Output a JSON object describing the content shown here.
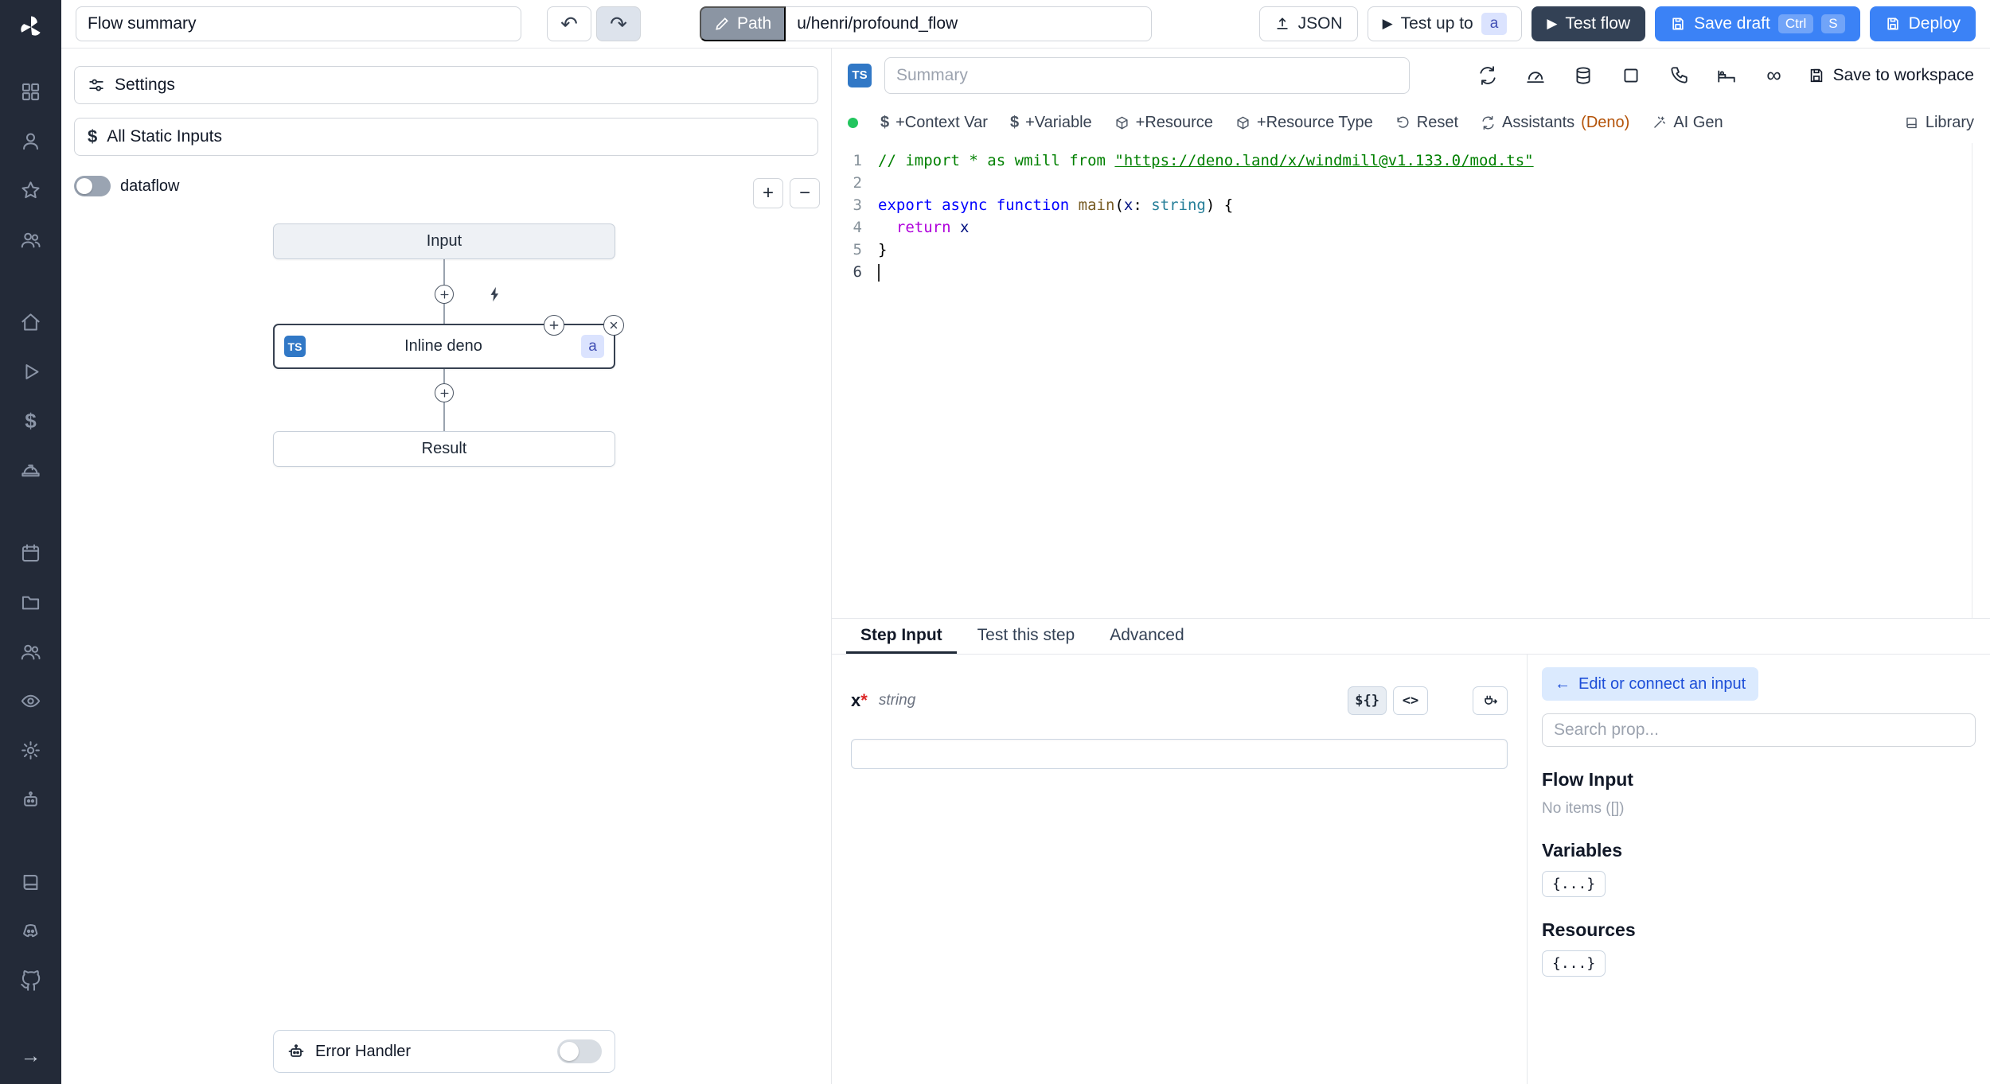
{
  "colors": {
    "accent_blue": "#3b82f6",
    "dark_button": "#334155",
    "ts_badge": "#3178c6",
    "green_dot": "#22c55e",
    "sidebar_bg": "#232a38"
  },
  "icons": {
    "arrow_left": "←",
    "arrow_right": "→",
    "undo": "↶",
    "redo": "↷",
    "play": "▶",
    "dollar": "$",
    "infinity": "∞",
    "plus": "+",
    "minus": "−",
    "dollar_braces": "${}",
    "code_tag": "<>"
  },
  "sidebar": {
    "icon_names": [
      "windmill-logo",
      "apps-grid",
      "user",
      "star",
      "users",
      "home",
      "play",
      "dollar",
      "hard-hat",
      "calendar",
      "folder",
      "members",
      "eye",
      "gear",
      "robot",
      "book",
      "discord",
      "github",
      "expand-arrow"
    ]
  },
  "topbar": {
    "flow_summary_value": "Flow summary",
    "path_label": "Path",
    "path_value": "u/henri/profound_flow",
    "json_label": "JSON",
    "test_up_to_label": "Test up to",
    "test_up_to_badge": "a",
    "test_flow_label": "Test flow",
    "save_draft_label": "Save draft",
    "kbd_ctrl": "Ctrl",
    "kbd_s": "S",
    "deploy_label": "Deploy"
  },
  "flow": {
    "settings_label": "Settings",
    "static_inputs_label": "All Static Inputs",
    "dataflow_label": "dataflow",
    "input_node": "Input",
    "inline_node": "Inline deno",
    "inline_lang_badge": "TS",
    "inline_badge": "a",
    "result_node": "Result",
    "error_handler_label": "Error Handler"
  },
  "editor": {
    "lang_badge": "TS",
    "summary_placeholder": "Summary",
    "save_to_workspace": "Save to workspace",
    "header_icon_names": [
      "restart",
      "gauge",
      "database",
      "concurrency-square",
      "phone",
      "sleep",
      "infinity"
    ],
    "toolbar": {
      "context_var": "+Context Var",
      "variable": "+Variable",
      "resource": "+Resource",
      "resource_type": "+Resource Type",
      "reset": "Reset",
      "assistants": "Assistants",
      "assistants_lang": "(Deno)",
      "ai_gen": "AI Gen",
      "library": "Library"
    },
    "code": {
      "cursor_line": 6,
      "lines": [
        [
          [
            "// import * as wmill from ",
            "cm"
          ],
          [
            "\"https://deno.land/x/windmill@v1.133.0/mod.ts\"",
            "cml"
          ]
        ],
        [],
        [
          [
            "export async function ",
            "kw"
          ],
          [
            "main",
            "fn"
          ],
          [
            "(",
            "pl"
          ],
          [
            "x",
            "pr"
          ],
          [
            ": ",
            "pl"
          ],
          [
            "string",
            "ty"
          ],
          [
            ") {",
            "pl"
          ]
        ],
        [
          [
            "  ",
            "pl"
          ],
          [
            "return",
            "ct"
          ],
          [
            " ",
            "pl"
          ],
          [
            "x",
            "pr"
          ]
        ],
        [
          [
            "}",
            "pl"
          ]
        ],
        []
      ]
    }
  },
  "tabs": [
    {
      "label": "Step Input"
    },
    {
      "label": "Test this step"
    },
    {
      "label": "Advanced"
    }
  ],
  "step_input": {
    "param_name": "x",
    "required_mark": "*",
    "param_type": "string",
    "value": ""
  },
  "props": {
    "edit_connect": "Edit or connect an input",
    "search_placeholder": "Search prop...",
    "flow_input_title": "Flow Input",
    "no_items": "No items ([])",
    "variables_title": "Variables",
    "variables_chip": "{...}",
    "resources_title": "Resources",
    "resources_chip": "{...}"
  }
}
